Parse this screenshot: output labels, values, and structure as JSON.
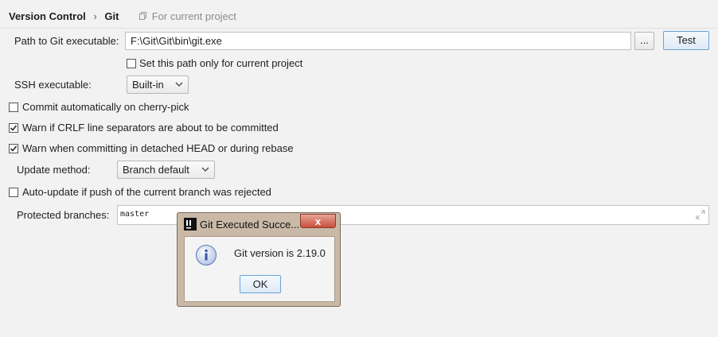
{
  "breadcrumb": {
    "section": "Version Control",
    "separator": "›",
    "page": "Git",
    "scope_note": "For current project"
  },
  "git_path": {
    "label": "Path to Git executable:",
    "value": "F:\\Git\\Git\\bin\\git.exe",
    "browse_label": "...",
    "test_label": "Test"
  },
  "path_only_project": {
    "label": "Set this path only for current project",
    "checked": false
  },
  "ssh": {
    "label": "SSH executable:",
    "value": "Built-in"
  },
  "options": {
    "cherry_pick": {
      "label": "Commit automatically on cherry-pick",
      "checked": false
    },
    "crlf": {
      "label": "Warn if CRLF line separators are about to be committed",
      "checked": true
    },
    "detached": {
      "label": "Warn when committing in detached HEAD or during rebase",
      "checked": true
    }
  },
  "update_method": {
    "label": "Update method:",
    "value": "Branch default"
  },
  "auto_update": {
    "label": "Auto-update if push of the current branch was rejected",
    "checked": false
  },
  "protected_branches": {
    "label": "Protected branches:",
    "value": "master"
  },
  "dialog": {
    "title": "Git Executed Succe...",
    "close": "x",
    "message": "Git version is 2.19.0",
    "ok_label": "OK"
  },
  "colors": {
    "default_button_border": "#6aa2d8",
    "dialog_frame": "#c9b9a6",
    "close_button": "#c8503d",
    "info_icon": "#4a6fc4"
  }
}
